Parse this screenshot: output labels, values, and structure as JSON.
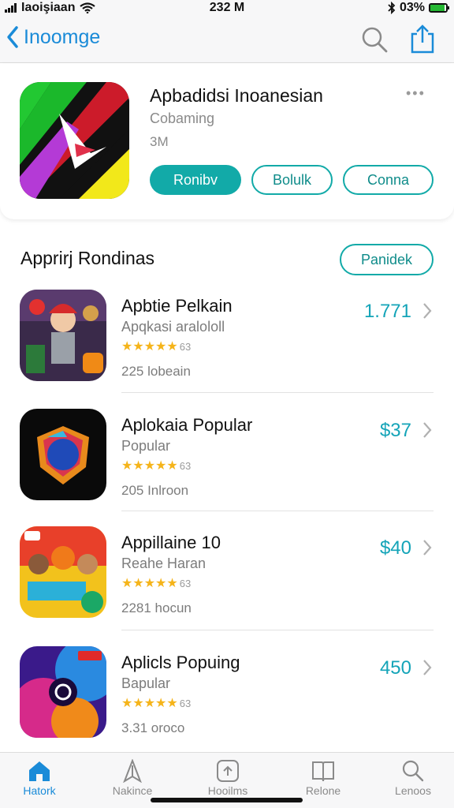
{
  "status_bar": {
    "carrier": "Iaoişiaan",
    "time": "232 M",
    "battery": "03%",
    "battery_level": 0.9,
    "icons": [
      "signal-icon",
      "wifi-icon",
      "bluetooth-icon",
      "battery-icon"
    ]
  },
  "nav": {
    "back_label": "Inoomge",
    "icons": [
      "chevron-left-icon",
      "search-icon",
      "share-icon"
    ]
  },
  "featured": {
    "title": "Apbadidsi Inoanesian",
    "subtitle": "Cobaming",
    "size": "3M",
    "more": "•••",
    "buttons": {
      "primary": "Ronibv",
      "secondary": "Bolulk",
      "tertiary": "Conna"
    }
  },
  "section": {
    "title": "Apprirj Rondinas",
    "button": "Panidek"
  },
  "apps": [
    {
      "title": "Apbtie Pelkain",
      "subtitle": "Apqkasi aralololl",
      "stars": "★★★★★",
      "rating_count": "63",
      "count": "225 lobeain",
      "price": "1.771"
    },
    {
      "title": "Aplokaia Popular",
      "subtitle": "Popular",
      "stars": "★★★★★",
      "rating_count": "63",
      "count": "205 Inlroon",
      "price": "$37"
    },
    {
      "title": "Appillaine 10",
      "subtitle": "Reahe Haran",
      "stars": "★★★★★",
      "rating_count": "63",
      "count": "2281 hocun",
      "price": "$40"
    },
    {
      "title": "Aplicls Popuing",
      "subtitle": "Bapular",
      "stars": "★★★★★",
      "rating_count": "63",
      "count": "3.31 oroco",
      "price": "450"
    }
  ],
  "tabs": [
    {
      "label": "Hatork",
      "icon": "home-icon",
      "active": true
    },
    {
      "label": "Nakince",
      "icon": "compass-icon",
      "active": false
    },
    {
      "label": "Hooilms",
      "icon": "apps-icon",
      "active": false
    },
    {
      "label": "Relone",
      "icon": "book-icon",
      "active": false
    },
    {
      "label": "Lenoos",
      "icon": "search-icon",
      "active": false
    }
  ],
  "colors": {
    "accent": "#12aaa8",
    "link": "#1a8bd8",
    "price": "#14a4b8",
    "star": "#f5b41a"
  }
}
